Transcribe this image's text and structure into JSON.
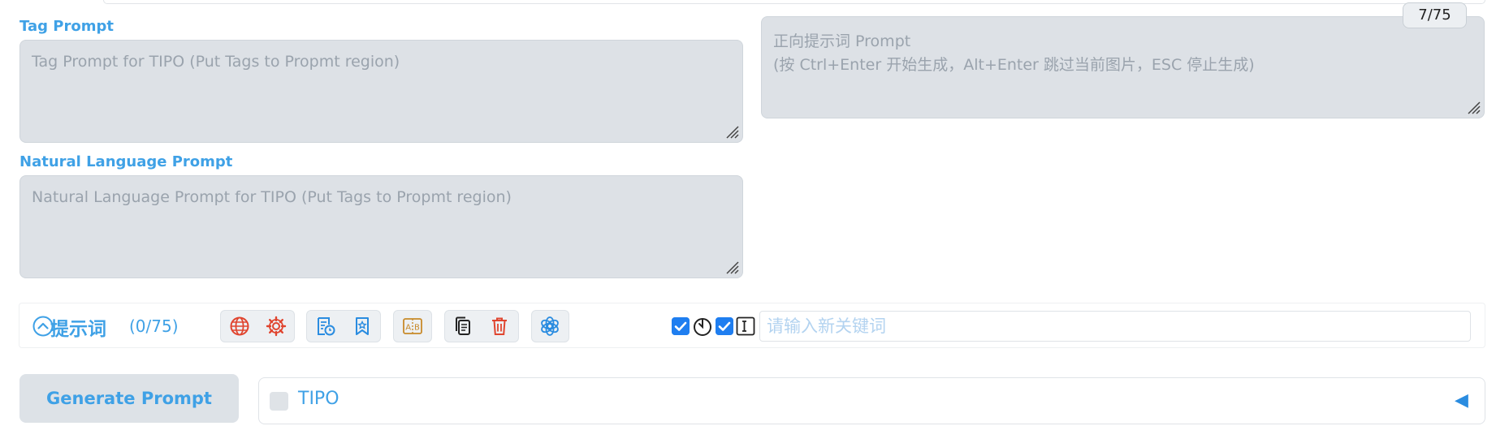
{
  "tag_prompt": {
    "label": "Tag Prompt",
    "placeholder": "Tag Prompt for TIPO (Put Tags to Propmt region)"
  },
  "positive_prompt": {
    "placeholder": "正向提示词 Prompt\n(按 Ctrl+Enter 开始生成，Alt+Enter 跳过当前图片，ESC 停止生成)",
    "token_counter": "7/75"
  },
  "natural_language_prompt": {
    "label": "Natural Language Prompt",
    "placeholder": "Natural Language Prompt for TIPO (Put Tags to Propmt region)"
  },
  "toolbar": {
    "title": "提示词",
    "count": "(0/75)",
    "keyword_placeholder": "请输入新关键词",
    "icons": [
      "globe-icon",
      "gear-icon",
      "history-icon",
      "bookmark-icon",
      "ab-translate-icon",
      "copy-icon",
      "trash-icon",
      "openai-icon",
      "check-icon",
      "timer-icon",
      "check-icon",
      "text-cursor-icon"
    ],
    "colors": {
      "accent": "#3fa1e6",
      "checkbox": "#1f7ef0",
      "danger": "#e0452f",
      "warning": "#c88a2a"
    }
  },
  "generate_button": {
    "label": "Generate Prompt"
  },
  "tipo": {
    "label": "TIPO",
    "toggle": "◀"
  }
}
